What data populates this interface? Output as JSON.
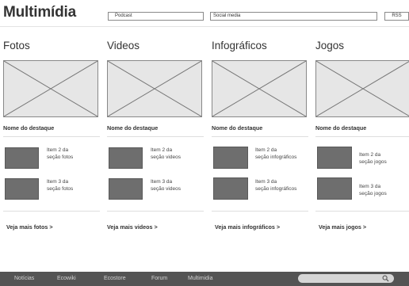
{
  "header": {
    "title": "Multimídia",
    "podcast_label": "Podcast",
    "social_label": "Social media",
    "rss_label": "RSS"
  },
  "sections": [
    {
      "title": "Fotos",
      "featured_name": "Nome do destaque",
      "items": [
        {
          "line1": "Item 2 da",
          "line2": "seção fotos"
        },
        {
          "line1": "Item 3 da",
          "line2": "seção fotos"
        }
      ],
      "see_more": "Veja mais fotos >"
    },
    {
      "title": "Videos",
      "featured_name": "Nome do destaque",
      "items": [
        {
          "line1": "Item 2 da",
          "line2": "seção videos"
        },
        {
          "line1": "Item 3 da",
          "line2": "seção videos"
        }
      ],
      "see_more": "Veja mais videos >"
    },
    {
      "title": "Infográficos",
      "featured_name": "Nome do destaque",
      "items": [
        {
          "line1": "Item 2 da",
          "line2": "seção infográficos"
        },
        {
          "line1": "Item 3 da",
          "line2": "seção infográficos"
        }
      ],
      "see_more": "Veja mais infográficos >"
    },
    {
      "title": "Jogos",
      "featured_name": "Nome do destaque",
      "items": [
        {
          "line1": "Item 2 da",
          "line2": "seção jogos"
        },
        {
          "line1": "Item 3 da",
          "line2": "seção jogos"
        }
      ],
      "see_more": "Veja mais jogos >"
    }
  ],
  "footer": {
    "links": [
      "Notícias",
      "Ecowiki",
      "Ecostore",
      "Forum",
      "Multimidia"
    ],
    "search_icon": "search-icon"
  },
  "colors": {
    "footer_bg": "#545454",
    "thumb_fill": "#6e6e6e",
    "text": "#333333"
  }
}
